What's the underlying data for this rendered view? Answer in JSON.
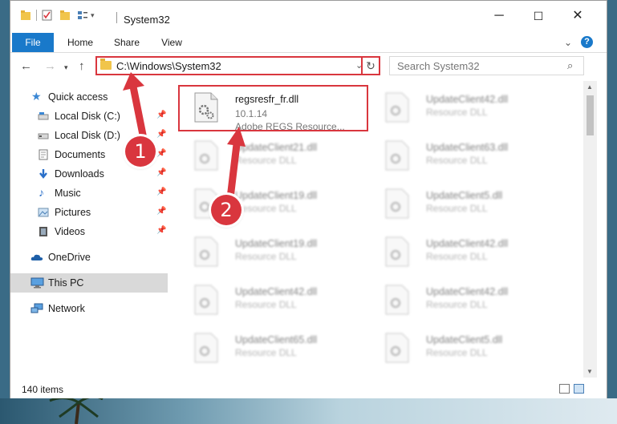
{
  "window": {
    "title": "System32",
    "controls": {
      "minimize": "─",
      "maximize": "☐",
      "close": "✕"
    }
  },
  "ribbon": {
    "tabs": [
      "File",
      "Home",
      "Share",
      "View"
    ],
    "help": "?"
  },
  "address": {
    "path": "C:\\Windows\\System32",
    "search_placeholder": "Search System32"
  },
  "sidebar": {
    "items": [
      {
        "label": "Quick access",
        "icon": "star-icon"
      },
      {
        "label": "Local Disk (C:)",
        "icon": "drive-icon",
        "pinned": true
      },
      {
        "label": "Local Disk (D:)",
        "icon": "drive-icon",
        "pinned": true
      },
      {
        "label": "Documents",
        "icon": "documents-icon",
        "pinned": true
      },
      {
        "label": "Downloads",
        "icon": "downloads-icon",
        "pinned": true
      },
      {
        "label": "Music",
        "icon": "music-icon",
        "pinned": true
      },
      {
        "label": "Pictures",
        "icon": "pictures-icon",
        "pinned": true
      },
      {
        "label": "Videos",
        "icon": "videos-icon",
        "pinned": true
      },
      {
        "label": "OneDrive",
        "icon": "cloud-icon"
      },
      {
        "label": "This PC",
        "icon": "computer-icon",
        "selected": true
      },
      {
        "label": "Network",
        "icon": "network-icon"
      }
    ]
  },
  "files": {
    "highlighted": {
      "name": "regsresfr_fr.dll",
      "version": "10.1.14",
      "description": "Adobe REGS Resource..."
    },
    "blurred": [
      {
        "name": "UpdateClient42.dll",
        "description": "Resource DLL"
      },
      {
        "name": "UpdateClient21.dll",
        "description": "Resource DLL"
      },
      {
        "name": "UpdateClient63.dll",
        "description": "Resource DLL"
      },
      {
        "name": "UpdateClient19.dll",
        "description": "Resource DLL"
      },
      {
        "name": "UpdateClient5.dll",
        "description": "Resource DLL"
      },
      {
        "name": "UpdateClient19.dll",
        "description": "Resource DLL"
      },
      {
        "name": "UpdateClient42.dll",
        "description": "Resource DLL"
      },
      {
        "name": "UpdateClient42.dll",
        "description": "Resource DLL"
      },
      {
        "name": "UpdateClient42.dll",
        "description": "Resource DLL"
      },
      {
        "name": "UpdateClient65.dll",
        "description": "Resource DLL"
      },
      {
        "name": "UpdateClient5.dll",
        "description": "Resource DLL"
      }
    ]
  },
  "status": {
    "item_count": "140 items"
  },
  "callouts": [
    "1",
    "2"
  ],
  "colors": {
    "accent": "#1979ca",
    "highlight_red": "#d9363e",
    "folder_yellow": "#f1c54b"
  }
}
